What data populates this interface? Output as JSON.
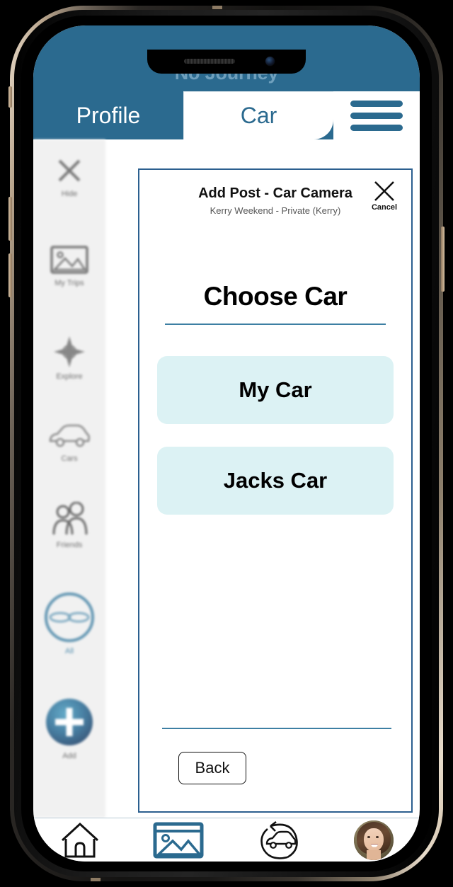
{
  "app": {
    "journey_status": "No Journey",
    "tabs": [
      {
        "label": "Profile",
        "active": false
      },
      {
        "label": "Car",
        "active": true
      }
    ],
    "menu_icon": "hamburger-menu-icon"
  },
  "sidebar": {
    "items": [
      {
        "label": "Hide",
        "icon": "close-x-icon"
      },
      {
        "label": "My Trips",
        "icon": "photo-gallery-icon"
      },
      {
        "label": "Explore",
        "icon": "compass-icon"
      },
      {
        "label": "Cars",
        "icon": "car-icon"
      },
      {
        "label": "Friends",
        "icon": "people-icon"
      },
      {
        "label": "All",
        "icon": "all-circle-icon"
      },
      {
        "label": "Add",
        "icon": "plus-circle-icon"
      }
    ]
  },
  "modal": {
    "title": "Add Post - Car Camera",
    "subtitle": "Kerry Weekend - Private (Kerry)",
    "cancel": {
      "label": "Cancel",
      "icon": "close-x-icon"
    },
    "heading": "Choose Car",
    "options": [
      {
        "label": "My Car"
      },
      {
        "label": "Jacks Car"
      }
    ],
    "back_label": "Back"
  },
  "bottom_nav": {
    "items": [
      {
        "name": "home",
        "icon": "home-icon",
        "active": false
      },
      {
        "name": "gallery",
        "icon": "photo-gallery-icon",
        "active": true
      },
      {
        "name": "car-sync",
        "icon": "car-refresh-icon",
        "active": false
      },
      {
        "name": "profile",
        "icon": "avatar-icon",
        "active": false
      }
    ]
  },
  "colors": {
    "header_blue": "#2b6a8f",
    "journey_text": "#6fa0bd",
    "accent_blue": "#3d7fa3",
    "option_fill": "#dcf2f4",
    "modal_border": "#2b5f8f"
  }
}
